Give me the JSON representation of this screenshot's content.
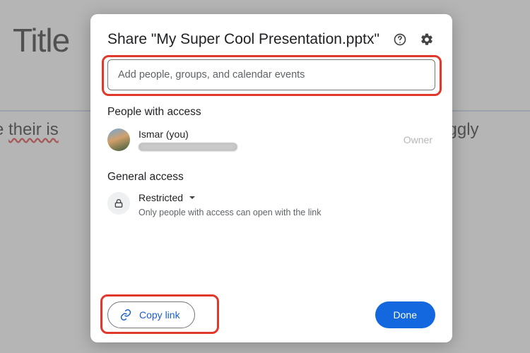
{
  "background": {
    "title": "Title",
    "text_prefix": "time ",
    "text_underlined": "their is",
    "text_suffix": " a squiggly"
  },
  "dialog": {
    "title": "Share \"My Super Cool Presentation.pptx\"",
    "help_icon": "help-icon",
    "settings_icon": "gear-icon",
    "add_placeholder": "Add people, groups, and calendar events",
    "people_heading": "People with access",
    "person": {
      "name": "Ismar (you)",
      "role": "Owner"
    },
    "general_heading": "General access",
    "access": {
      "level": "Restricted",
      "description": "Only people with access can open with the link"
    },
    "copy_link_label": "Copy link",
    "done_label": "Done"
  }
}
